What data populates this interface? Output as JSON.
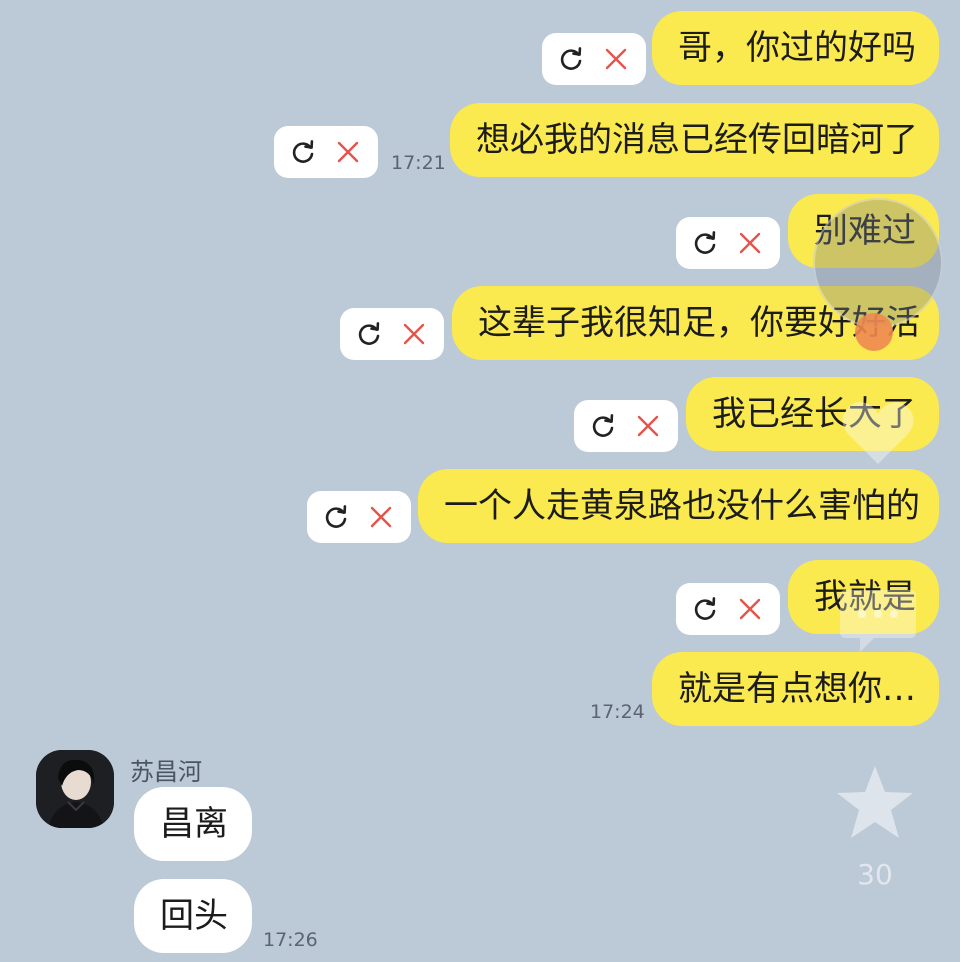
{
  "messages_out": [
    {
      "text": "哥，你过的好吗"
    },
    {
      "text": "想必我的消息已经传回暗河了",
      "time": "17:21"
    },
    {
      "text": "别难过"
    },
    {
      "text": "这辈子我很知足，你要好好活"
    },
    {
      "text": "我已经长大了"
    },
    {
      "text": "一个人走黄泉路也没什么害怕的"
    },
    {
      "text": "我就是"
    },
    {
      "text": "就是有点想你…",
      "time": "17:24"
    }
  ],
  "incoming": {
    "sender": "苏昌河",
    "messages": [
      {
        "text": "昌离"
      },
      {
        "text": "回头",
        "time": "17:26"
      }
    ]
  },
  "overlay": {
    "like_count": "30"
  },
  "icons": {
    "retry": "refresh-icon",
    "cancel": "close-icon",
    "like": "star-icon"
  },
  "colors": {
    "background": "#bcc9d6",
    "outgoing_bubble": "#fae94f",
    "incoming_bubble": "#ffffff",
    "cancel_x": "#e4544c"
  }
}
